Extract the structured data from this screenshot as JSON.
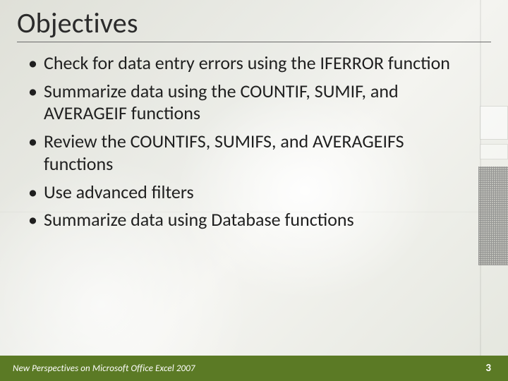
{
  "title": "Objectives",
  "bullets": [
    "Check for data entry errors using the IFERROR function",
    "Summarize data using the COUNTIF, SUMIF, and AVERAGEIF functions",
    "Review the COUNTIFS, SUMIFS, and AVERAGEIFS functions",
    "Use advanced filters",
    "Summarize data using Database functions"
  ],
  "footer": {
    "source": "New Perspectives on Microsoft Office Excel 2007",
    "page": "3"
  },
  "colors": {
    "footer_bg": "#5b7a25",
    "text": "#1f1f1f"
  }
}
